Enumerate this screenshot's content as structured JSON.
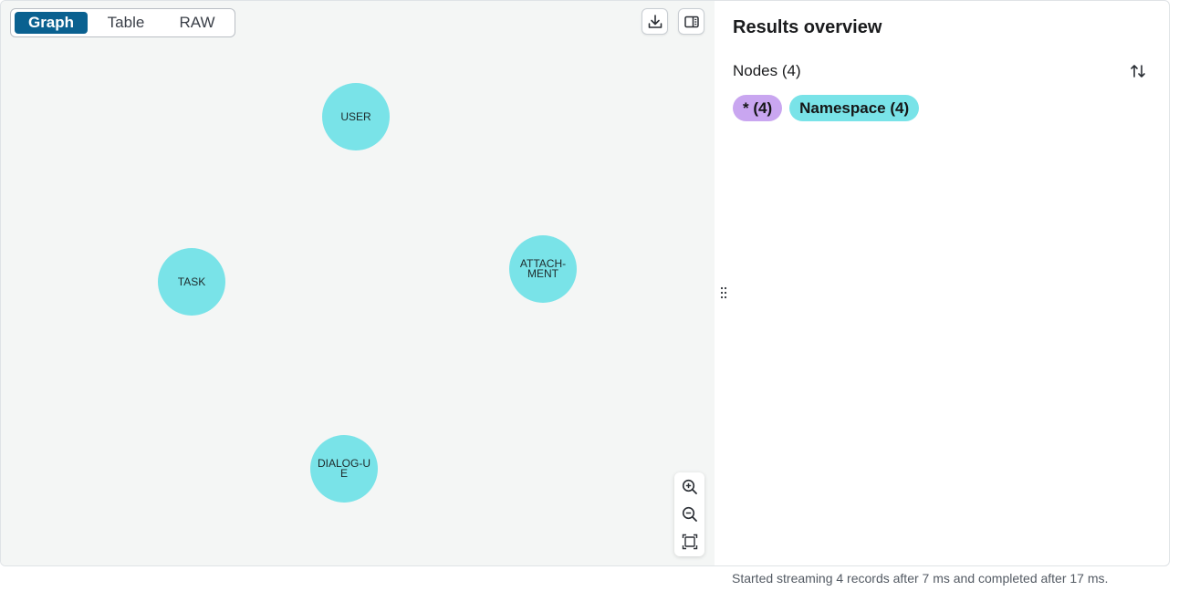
{
  "view_toggle": {
    "graph_label": "Graph",
    "table_label": "Table",
    "raw_label": "RAW",
    "selected": "Graph"
  },
  "toolbar": {
    "download_icon": "download-icon",
    "sidebar_toggle_icon": "panel-toggle-icon"
  },
  "graph": {
    "nodes": [
      {
        "label": "USER",
        "color": "#79e3e8"
      },
      {
        "label": "TASK",
        "color": "#79e3e8"
      },
      {
        "label": "ATTACH-MENT",
        "color": "#79e3e8"
      },
      {
        "label": "DIALOG-UE",
        "color": "#79e3e8"
      }
    ]
  },
  "zoom_controls": {
    "zoom_in_icon": "zoom-in-icon",
    "zoom_out_icon": "zoom-out-icon",
    "fit_icon": "fit-to-screen-icon"
  },
  "sidebar": {
    "title": "Results overview",
    "nodes_heading": "Nodes (4)",
    "sort_icon": "sort-icon",
    "chips": [
      {
        "label": "* (4)",
        "color": "#c9a6f0"
      },
      {
        "label": "Namespace (4)",
        "color": "#79e3e8"
      }
    ]
  },
  "status": {
    "text": "Started streaming 4 records after 7 ms and completed after 17 ms."
  },
  "colors": {
    "accent": "#0a6190",
    "node_fill": "#79e3e8",
    "chip_all": "#c9a6f0",
    "canvas_bg": "#f4f6f5"
  }
}
